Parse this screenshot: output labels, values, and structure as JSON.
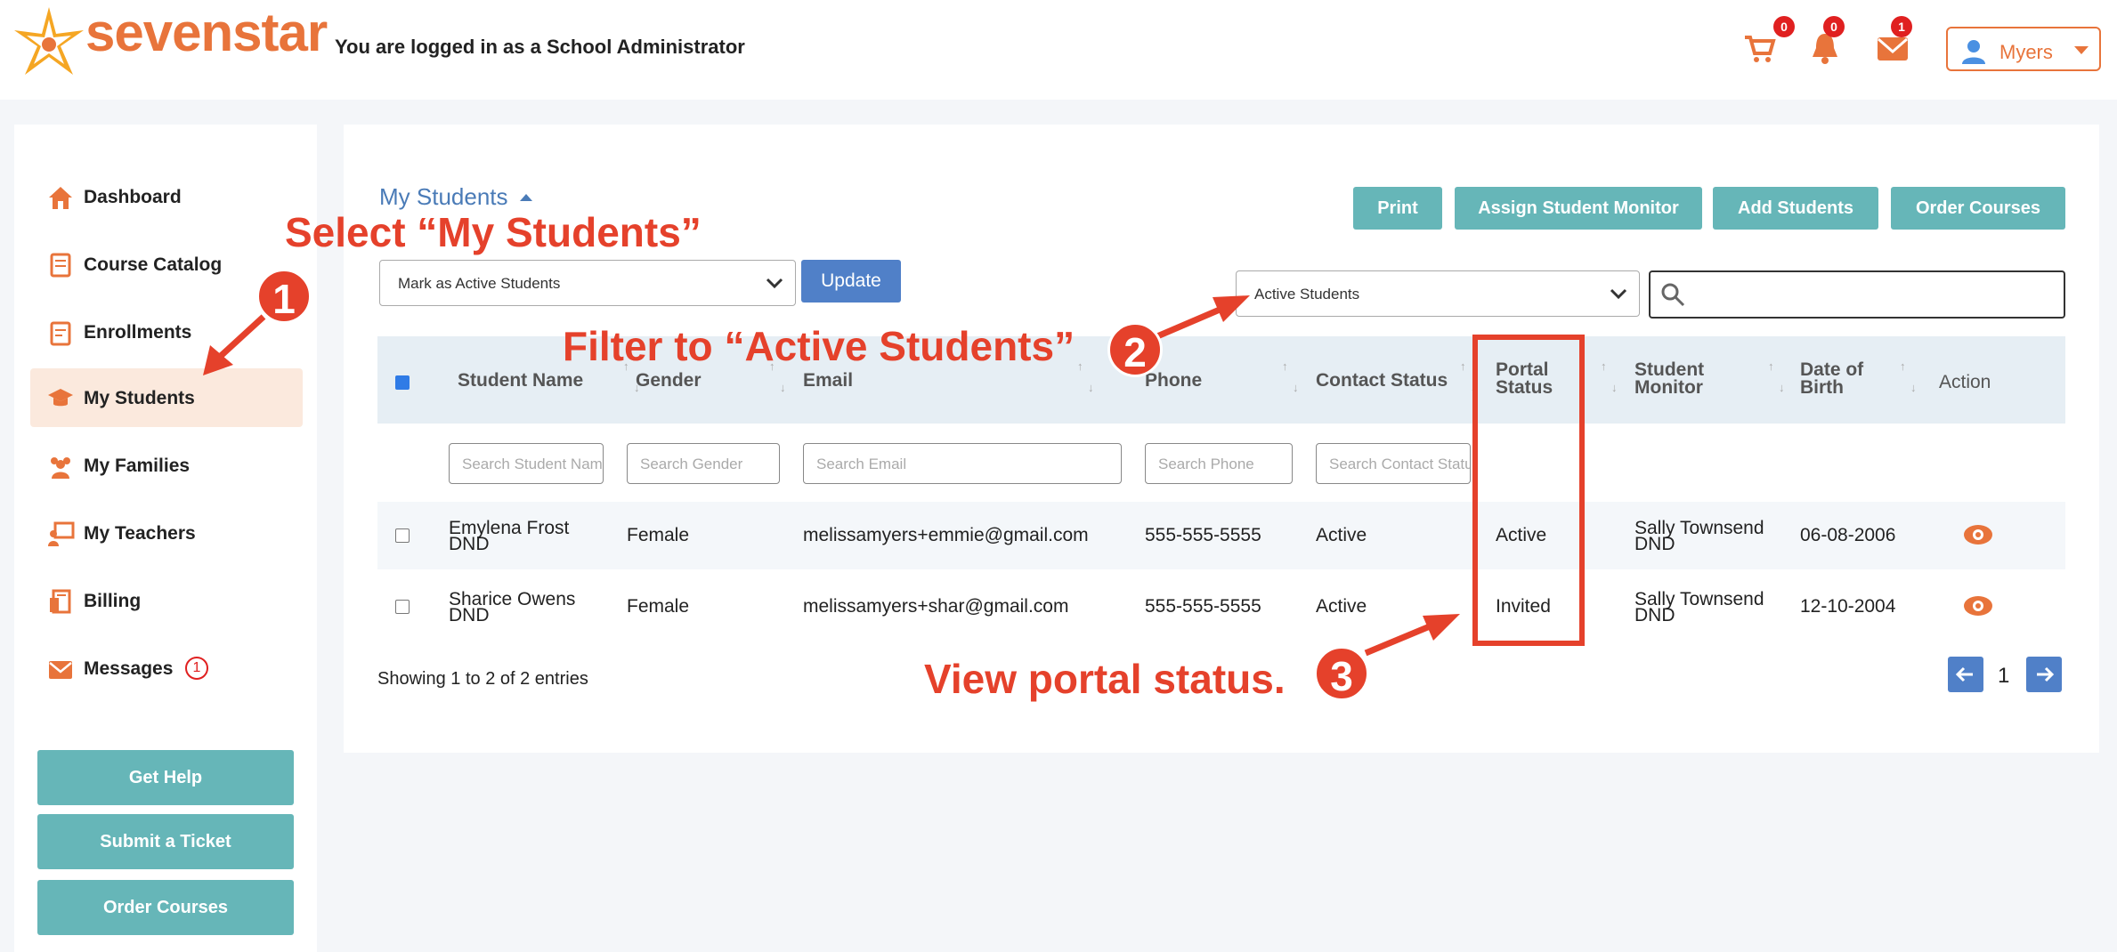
{
  "header": {
    "brand": "sevenstar",
    "logged_in_text": "You are logged in as a School Administrator",
    "cart_count": "0",
    "notifications_count": "0",
    "mail_count": "1",
    "user_name": "Myers"
  },
  "sidebar": {
    "items": [
      {
        "label": "Dashboard",
        "icon": "home-icon"
      },
      {
        "label": "Course Catalog",
        "icon": "book-icon"
      },
      {
        "label": "Enrollments",
        "icon": "clipboard-icon"
      },
      {
        "label": "My Students",
        "icon": "graduation-cap-icon"
      },
      {
        "label": "My Families",
        "icon": "users-icon"
      },
      {
        "label": "My Teachers",
        "icon": "teacher-icon"
      },
      {
        "label": "Billing",
        "icon": "receipt-icon"
      },
      {
        "label": "Messages",
        "icon": "envelope-icon"
      }
    ],
    "messages_badge": "1",
    "buttons": {
      "get_help": "Get Help",
      "submit_ticket": "Submit a Ticket",
      "order_courses": "Order Courses"
    }
  },
  "main": {
    "title": "My Students",
    "toolbar": {
      "print": "Print",
      "assign_monitor": "Assign Student Monitor",
      "add_students": "Add Students",
      "order_courses": "Order Courses"
    },
    "bulk_action_value": "Mark as Active Students",
    "update_label": "Update",
    "filter_value": "Active Students",
    "search_value": "",
    "columns": {
      "student_name": "Student Name",
      "gender": "Gender",
      "email": "Email",
      "phone": "Phone",
      "contact_status": "Contact Status",
      "portal_status_1": "Portal",
      "portal_status_2": "Status",
      "student_monitor_1": "Student",
      "student_monitor_2": "Monitor",
      "dob_1": "Date of",
      "dob_2": "Birth",
      "action": "Action"
    },
    "filters": {
      "student_name": "Search Student Name",
      "gender": "Search Gender",
      "email": "Search Email",
      "phone": "Search Phone",
      "contact_status": "Search Contact Status"
    },
    "rows": [
      {
        "name_1": "Emylena Frost",
        "name_2": "DND",
        "gender": "Female",
        "email": "melissamyers+emmie@gmail.com",
        "phone": "555-555-5555",
        "contact_status": "Active",
        "portal_status": "Active",
        "monitor_1": "Sally Townsend",
        "monitor_2": "DND",
        "dob": "06-08-2006"
      },
      {
        "name_1": "Sharice Owens",
        "name_2": "DND",
        "gender": "Female",
        "email": "melissamyers+shar@gmail.com",
        "phone": "555-555-5555",
        "contact_status": "Active",
        "portal_status": "Invited",
        "monitor_1": "Sally Townsend",
        "monitor_2": "DND",
        "dob": "12-10-2004"
      }
    ],
    "showing": "Showing 1 to 2 of 2 entries",
    "page": "1"
  },
  "annotations": {
    "step1_text": "Select “My Students”",
    "step1_num": "1",
    "step2_text": "Filter to “Active Students”",
    "step2_num": "2",
    "step3_text": "View portal status.",
    "step3_num": "3"
  },
  "colors": {
    "brand_orange": "#e8743b",
    "teal_button": "#66b6b8",
    "blue_button": "#5080c8",
    "annotation_red": "#e5412b",
    "active_nav": "#fbe9dd"
  }
}
